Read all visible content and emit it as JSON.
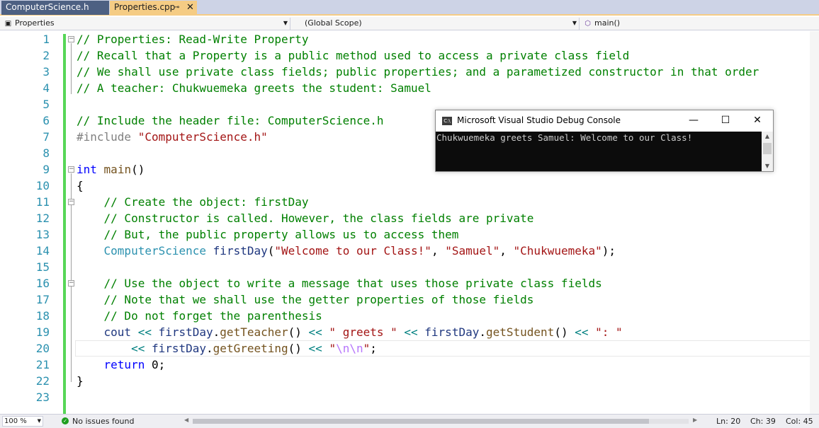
{
  "tabs": {
    "header_tab": "ComputerScience.h",
    "active_tab": "Properties.cpp",
    "pin_icon": "pin-icon",
    "close_icon": "close-icon"
  },
  "navbar": {
    "project": "Properties",
    "scope": "(Global Scope)",
    "member": "main()"
  },
  "code": {
    "line_numbers": [
      "1",
      "2",
      "3",
      "4",
      "5",
      "6",
      "7",
      "8",
      "9",
      "10",
      "11",
      "12",
      "13",
      "14",
      "15",
      "16",
      "17",
      "18",
      "19",
      "20",
      "21",
      "22",
      "23"
    ],
    "l1": "// Properties: Read-Write Property",
    "l2": "// Recall that a Property is a public method used to access a private class field",
    "l3": "// We shall use private class fields; public properties; and a parametized constructor in that order",
    "l4": "// A teacher: Chukwuemeka greets the student: Samuel",
    "l6": "// Include the header file: ComputerScience.h",
    "l7_directive": "#include",
    "l7_file": "\"ComputerScience.h\"",
    "l9_kw": "int",
    "l9_fn": "main",
    "l9_paren": "()",
    "l10": "{",
    "l11": "// Create the object: firstDay",
    "l12": "// Constructor is called. However, the class fields are private",
    "l13": "// But, the public property allows us to access them",
    "l14_type": "ComputerScience",
    "l14_var": "firstDay",
    "l14_open": "(",
    "l14_s1": "\"Welcome to our Class!\"",
    "l14_c1": ", ",
    "l14_s2": "\"Samuel\"",
    "l14_c2": ", ",
    "l14_s3": "\"Chukwuemeka\"",
    "l14_close": ");",
    "l16": "// Use the object to write a message that uses those private class fields",
    "l17": "// Note that we shall use the getter properties of those fields",
    "l18": "// Do not forget the parenthesis",
    "l19_cout": "cout",
    "l19_op1": " << ",
    "l19_obj1": "firstDay",
    "l19_dot1": ".",
    "l19_fn1": "getTeacher",
    "l19_p1": "()",
    "l19_op2": " << ",
    "l19_s1": "\" greets \"",
    "l19_op3": " << ",
    "l19_obj2": "firstDay",
    "l19_dot2": ".",
    "l19_fn2": "getStudent",
    "l19_p2": "()",
    "l19_op4": " << ",
    "l19_s2": "\": \"",
    "l20_op1": "<< ",
    "l20_obj": "firstDay",
    "l20_dot": ".",
    "l20_fn": "getGreeting",
    "l20_p": "()",
    "l20_op2": " << ",
    "l20_q1": "\"",
    "l20_esc": "\\n\\n",
    "l20_q2": "\"",
    "l20_end": ";",
    "l21_kw": "return",
    "l21_rest": " 0;",
    "l22": "}"
  },
  "console": {
    "title": "Microsoft Visual Studio Debug Console",
    "output": "Chukwuemeka greets Samuel: Welcome to our Class!",
    "app_icon_text": "C:\\",
    "minimize": "—",
    "maximize": "☐",
    "close": "✕"
  },
  "statusbar": {
    "zoom": "100 %",
    "issues": "No issues found",
    "ln": "Ln: 20",
    "ch": "Ch: 39",
    "col": "Col: 45"
  },
  "colors": {
    "comment": "#008000",
    "keyword": "#0000ff",
    "string": "#a31515",
    "type": "#2b91af",
    "change_bar": "#57d657",
    "active_tab": "#f5cc84"
  }
}
